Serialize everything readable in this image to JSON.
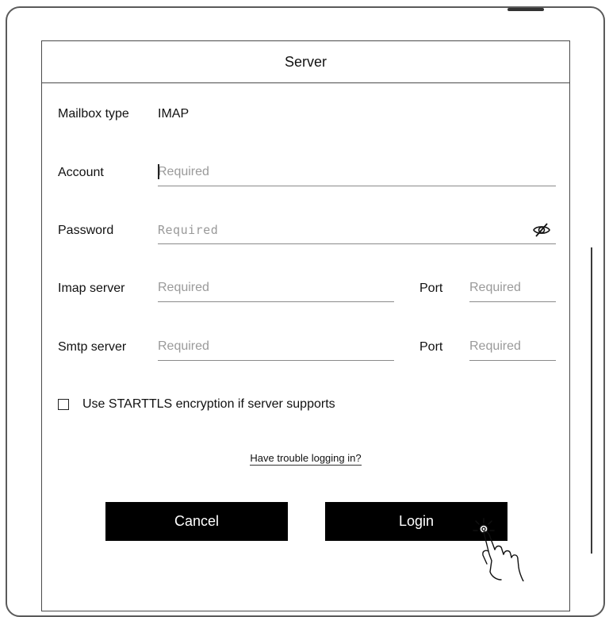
{
  "dialog": {
    "title": "Server"
  },
  "form": {
    "mailbox_type_label": "Mailbox type",
    "mailbox_type_value": "IMAP",
    "account_label": "Account",
    "account_placeholder": "Required",
    "password_label": "Password",
    "password_placeholder": "Required",
    "imap_server_label": "Imap server",
    "imap_server_placeholder": "Required",
    "imap_port_label": "Port",
    "imap_port_placeholder": "Required",
    "smtp_server_label": "Smtp server",
    "smtp_server_placeholder": "Required",
    "smtp_port_label": "Port",
    "smtp_port_placeholder": "Required",
    "starttls_label": "Use STARTTLS encryption if server supports",
    "starttls_checked": false
  },
  "links": {
    "trouble": "Have trouble logging in?"
  },
  "buttons": {
    "cancel": "Cancel",
    "login": "Login"
  },
  "icons": {
    "password_toggle": "eye-off-icon",
    "tap_gesture": "hand-pointer-icon"
  },
  "colors": {
    "button_bg": "#000000",
    "button_text": "#ffffff",
    "placeholder": "#9a9a9a"
  }
}
